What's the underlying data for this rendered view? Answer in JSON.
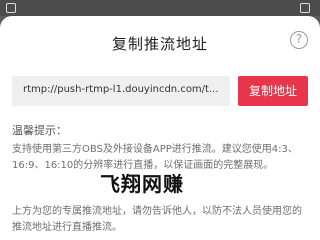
{
  "dialog": {
    "title": "复制推流地址",
    "help_icon": "?",
    "stream_url": "rtmp://push-rtmp-l1.douyincdn.com/t...",
    "copy_button": "复制地址",
    "copy_button_color": "#e8354b",
    "tips_title": "温馨提示：",
    "tips_paragraph_1": "支持使用第三方OBS及外接设备APP进行推流。建议您使用4:3、16:9、16:10的分辨率进行直播，以保证画面的完整展现。",
    "tips_paragraph_2": "上方为您的专属推流地址，请勿告诉他人，以防不法人员使用您的推流地址进行直播推流。"
  },
  "watermark": {
    "text": "飞翔网赚"
  }
}
